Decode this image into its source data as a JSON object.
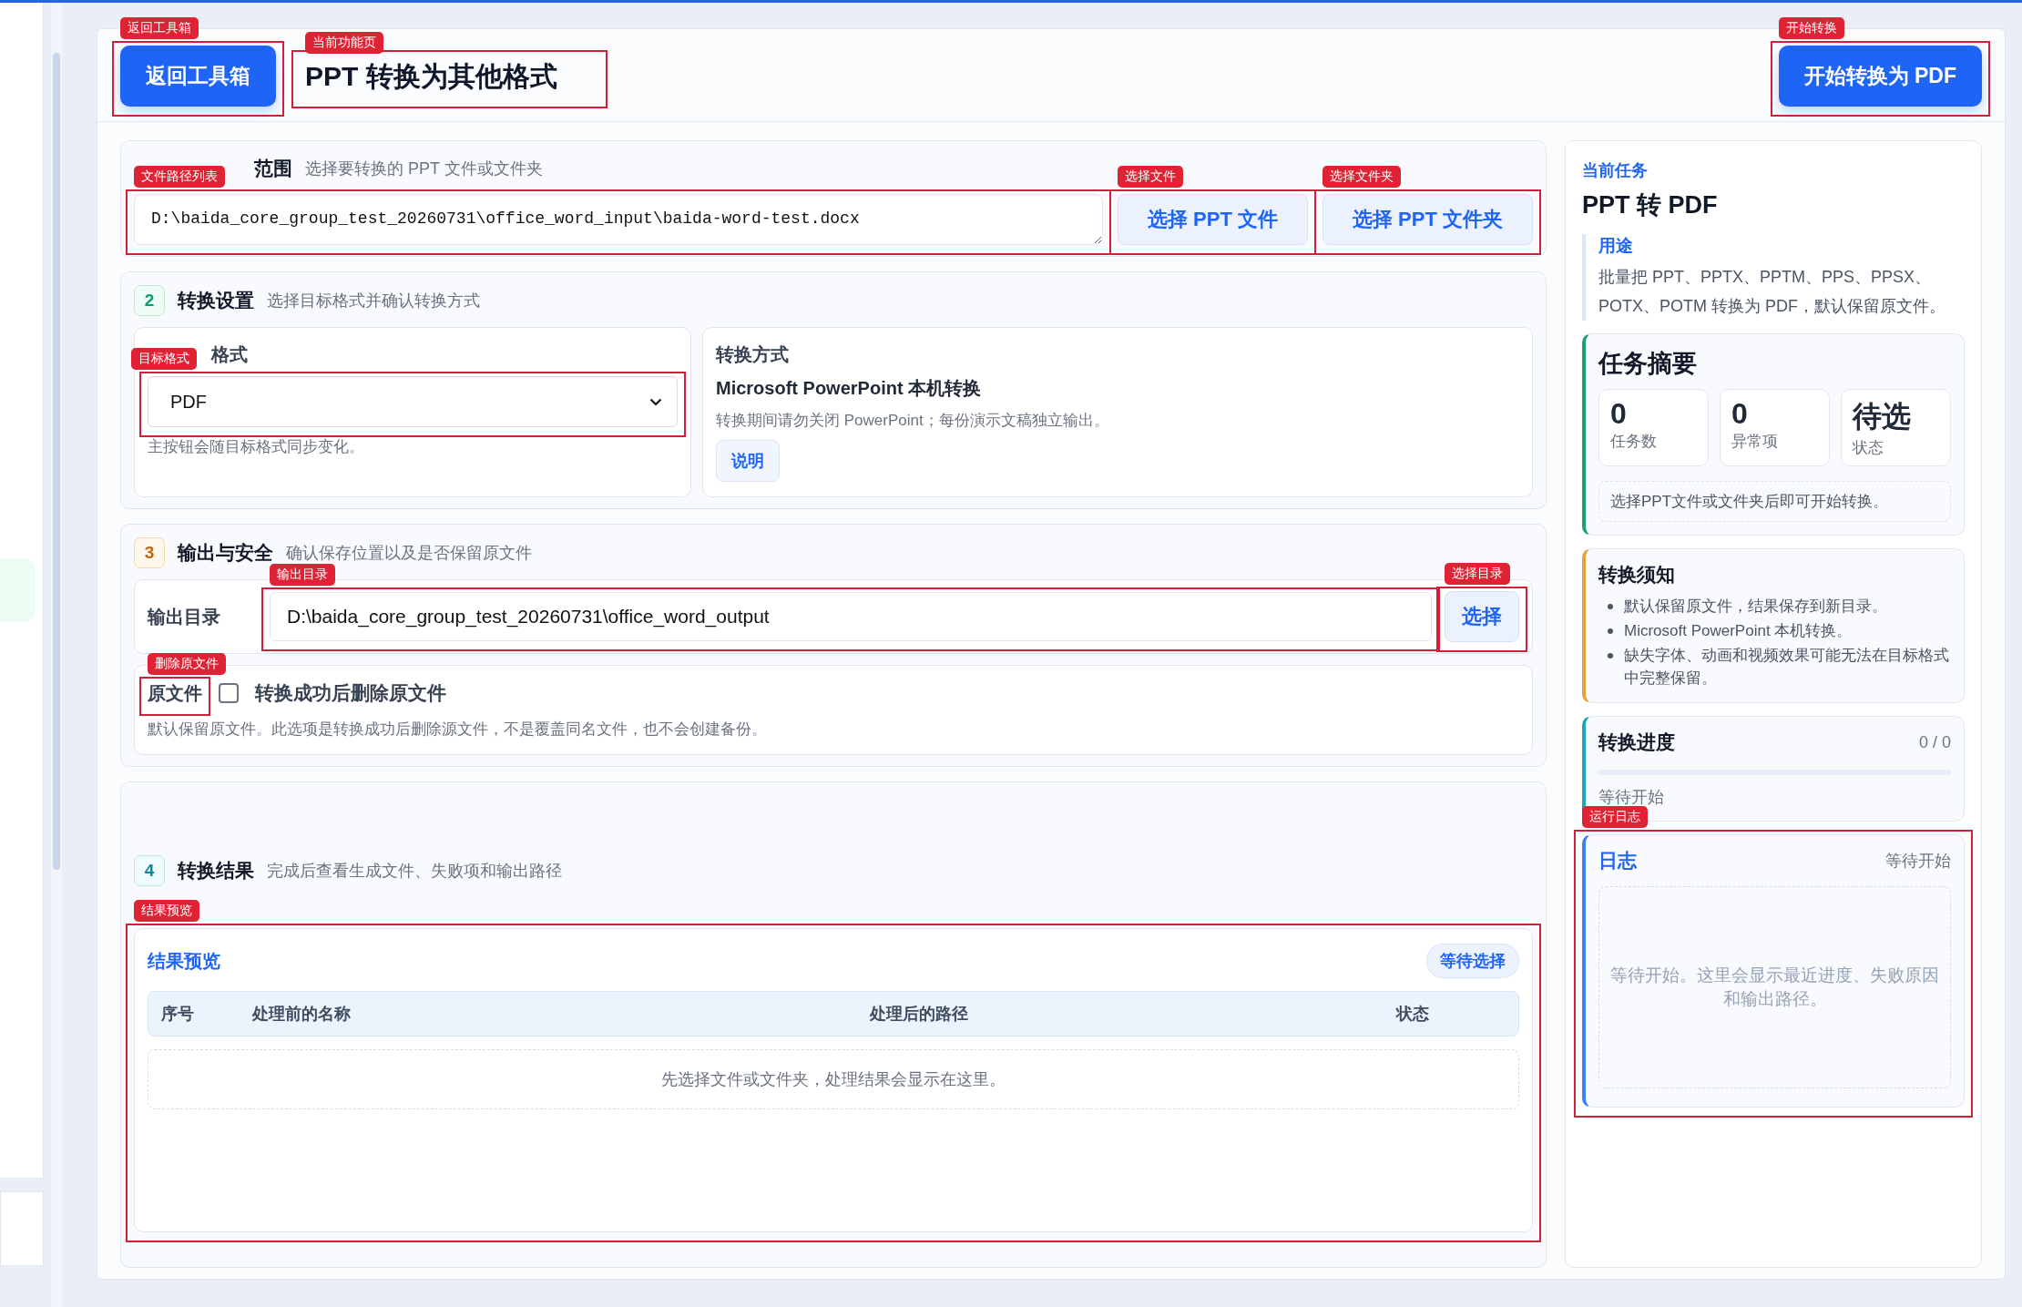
{
  "header": {
    "back_button": {
      "label": "返回工具箱",
      "annotation": "返回工具箱"
    },
    "title": {
      "text": "PPT 转换为其他格式",
      "annotation": "当前功能页"
    },
    "start_button": {
      "label": "开始转换为 PDF",
      "annotation": "开始转换"
    }
  },
  "source_section": {
    "title": "范围",
    "subtitle": "选择要转换的 PPT 文件或文件夹",
    "file_list": {
      "value": "D:\\baida_core_group_test_20260731\\office_word_input\\baida-word-test.docx",
      "annotation": "文件路径列表"
    },
    "buttons": [
      {
        "label": "选择 PPT 文件",
        "annotation": "选择文件"
      },
      {
        "label": "选择 PPT 文件夹",
        "annotation": "选择文件夹"
      }
    ]
  },
  "settings_section": {
    "number": "2",
    "title": "转换设置",
    "subtitle": "选择目标格式并确认转换方式",
    "target_format": {
      "label": "格式",
      "value": "PDF",
      "hint": "主按钮会随目标格式同步变化。",
      "annotation": "目标格式"
    },
    "method": {
      "label": "转换方式",
      "name": "Microsoft PowerPoint 本机转换",
      "note": "转换期间请勿关闭 PowerPoint；每份演示文稿独立输出。",
      "button": "说明"
    }
  },
  "output_section": {
    "number": "3",
    "title": "输出与安全",
    "subtitle": "确认保存位置以及是否保留原文件",
    "output_dir": {
      "label": "输出目录",
      "value": "D:\\baida_core_group_test_20260731\\office_word_output",
      "annotation": "输出目录",
      "button": {
        "label": "选择",
        "annotation": "选择目录"
      }
    },
    "delete_source": {
      "label": "原文件",
      "option": "转换成功后删除原文件",
      "checked": false,
      "note": "默认保留原文件。此选项是转换成功后删除源文件，不是覆盖同名文件，也不会创建备份。",
      "annotation": "删除原文件"
    }
  },
  "result_section": {
    "number": "4",
    "title": "转换结果",
    "subtitle": "完成后查看生成文件、失败项和输出路径",
    "preview": {
      "title": "结果预览",
      "badge": "等待选择",
      "columns": [
        "序号",
        "处理前的名称",
        "处理后的路径",
        "状态"
      ],
      "empty": "先选择文件或文件夹，处理结果会显示在这里。",
      "annotation": "结果预览"
    }
  },
  "task_panel": {
    "eyebrow": "当前任务",
    "title": "PPT 转 PDF",
    "purpose": {
      "label": "用途",
      "text": "批量把 PPT、PPTX、PPTM、PPS、PPSX、POTX、POTM 转换为 PDF，默认保留原文件。"
    },
    "summary": {
      "title": "任务摘要",
      "stats": [
        {
          "value": "0",
          "label": "任务数"
        },
        {
          "value": "0",
          "label": "异常项"
        },
        {
          "value": "待选",
          "label": "状态"
        }
      ],
      "hint": "选择PPT文件或文件夹后即可开始转换。"
    },
    "notice": {
      "title": "转换须知",
      "items": [
        "默认保留原文件，结果保存到新目录。",
        "Microsoft PowerPoint 本机转换。",
        "缺失字体、动画和视频效果可能无法在目标格式中完整保留。"
      ]
    },
    "progress": {
      "title": "转换进度",
      "count": "0 / 0",
      "level": 0,
      "status": "等待开始"
    },
    "log": {
      "title": "日志",
      "status": "等待开始",
      "empty": "等待开始。这里会显示最近进度、失败原因和输出路径。",
      "annotation": "运行日志"
    }
  }
}
